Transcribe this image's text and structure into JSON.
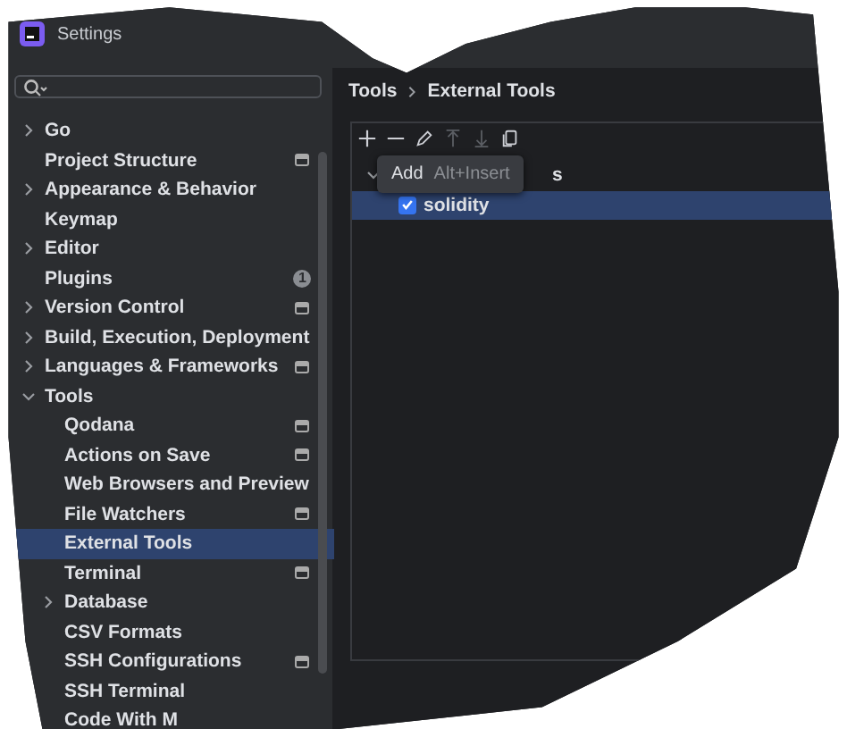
{
  "window": {
    "title": "Settings"
  },
  "sidebar": {
    "items": [
      {
        "label": "Go",
        "expanded": false,
        "selected": false
      },
      {
        "label": "Project Structure",
        "project_scoped": true,
        "selected": false
      },
      {
        "label": "Appearance & Behavior",
        "expanded": false,
        "selected": false
      },
      {
        "label": "Keymap",
        "selected": false
      },
      {
        "label": "Editor",
        "expanded": false,
        "selected": false
      },
      {
        "label": "Plugins",
        "badge": "1",
        "selected": false
      },
      {
        "label": "Version Control",
        "expanded": false,
        "project_scoped": true,
        "selected": false
      },
      {
        "label": "Build, Execution, Deployment",
        "expanded": false,
        "selected": false
      },
      {
        "label": "Languages & Frameworks",
        "expanded": false,
        "project_scoped": true,
        "selected": false
      },
      {
        "label": "Tools",
        "expanded": true,
        "selected": false,
        "children": [
          {
            "label": "Qodana",
            "project_scoped": true,
            "selected": false
          },
          {
            "label": "Actions on Save",
            "project_scoped": true,
            "selected": false
          },
          {
            "label": "Web Browsers and Preview",
            "selected": false
          },
          {
            "label": "File Watchers",
            "project_scoped": true,
            "selected": false
          },
          {
            "label": "External Tools",
            "selected": true
          },
          {
            "label": "Terminal",
            "project_scoped": true,
            "selected": false
          },
          {
            "label": "Database",
            "expanded": false,
            "selected": false
          },
          {
            "label": "CSV Formats",
            "selected": false
          },
          {
            "label": "SSH Configurations",
            "project_scoped": true,
            "selected": false
          },
          {
            "label": "SSH Terminal",
            "selected": false
          },
          {
            "label": "Code With M",
            "selected": false
          }
        ]
      }
    ]
  },
  "breadcrumb": [
    "Tools",
    "External Tools"
  ],
  "toolbar": [
    {
      "kind": "add",
      "disabled": false
    },
    {
      "kind": "remove",
      "disabled": false
    },
    {
      "kind": "edit",
      "disabled": false
    },
    {
      "kind": "up",
      "disabled": true
    },
    {
      "kind": "down",
      "disabled": true
    },
    {
      "kind": "copy",
      "disabled": false
    }
  ],
  "tooltip": {
    "label": "Add",
    "shortcut": "Alt+Insert"
  },
  "tree": {
    "group": {
      "label": "s",
      "expanded": true
    },
    "items": [
      {
        "label": "solidity",
        "checked": true,
        "selected": true
      }
    ]
  }
}
